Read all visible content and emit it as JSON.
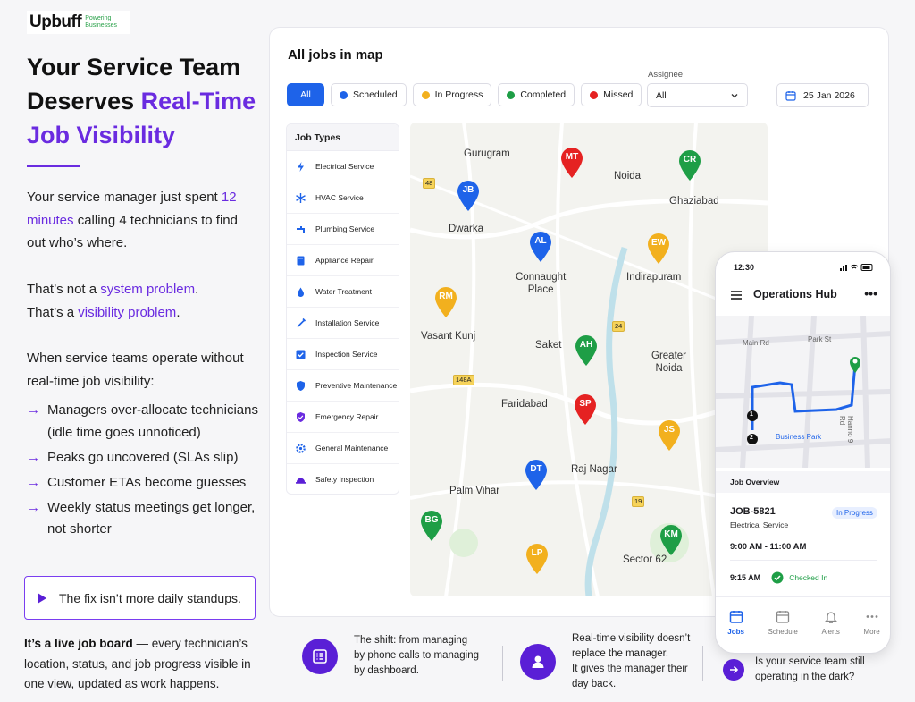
{
  "brand": {
    "name": "Upbuff",
    "tagline_1": "Powering",
    "tagline_2": "Businesses"
  },
  "hero": {
    "line1": "Your Service Team",
    "line2_a": "Deserves ",
    "line2_b": "Real-Time",
    "line3": "Job Visibility"
  },
  "intro": {
    "a": "Your service manager just spent ",
    "b": "12 minutes",
    "c": " calling 4 technicians to find out who’s where."
  },
  "problem": {
    "a1": "That’s not a ",
    "a2": "system problem",
    "a3": ".",
    "b1": "That’s a ",
    "b2": "visibility problem",
    "b3": "."
  },
  "lead": "When service teams operate without real-time job visibility:",
  "bullets": [
    "Managers over-allocate technicians (idle time goes unnoticed)",
    "Peaks go uncovered (SLAs slip)",
    "Customer ETAs become guesses",
    "Weekly status meetings get longer, not shorter"
  ],
  "callout": "The fix isn’t more daily standups.",
  "closing": {
    "bold": "It’s a live job board",
    "rest": " — every technician’s location, status, and job progress visible in one view, updated as work happens."
  },
  "card": {
    "title": "All jobs in map",
    "filters": [
      "All",
      "Scheduled",
      "In Progress",
      "Completed",
      "Missed"
    ],
    "filter_colors": [
      "#1e63e9",
      "#1e63e9",
      "#f2b01e",
      "#1e9e46",
      "#e52222"
    ],
    "assignee_label": "Assignee",
    "assignee_value": "All",
    "date": "25 Jan 2026",
    "job_types_title": "Job Types",
    "job_types": [
      "Electrical Service",
      "HVAC Service",
      "Plumbing Service",
      "Appliance Repair",
      "Water Treatment",
      "Installation Service",
      "Inspection Service",
      "Preventive Maintenance",
      "Emergency Repair",
      "General Maintenance",
      "Safety Inspection"
    ],
    "places": {
      "gurugram": "Gurugram",
      "noida": "Noida",
      "ghaziabad": "Ghaziabad",
      "dwarka": "Dwarka",
      "connaught_1": "Connaught",
      "connaught_2": "Place",
      "indirapuram": "Indirapuram",
      "vasant": "Vasant Kunj",
      "saket": "Saket",
      "greater_1": "Greater",
      "greater_2": "Noida",
      "faridabad": "Faridabad",
      "rajnagar": "Raj Nagar",
      "palam": "Palm Vihar",
      "sector": "Sector 62"
    },
    "roads": [
      "48",
      "24",
      "148A",
      "19"
    ],
    "pins": [
      {
        "initials": "MT",
        "color": "#e52222"
      },
      {
        "initials": "CR",
        "color": "#1e9e46"
      },
      {
        "initials": "JB",
        "color": "#1e63e9"
      },
      {
        "initials": "AL",
        "color": "#1e63e9"
      },
      {
        "initials": "EW",
        "color": "#f2b01e"
      },
      {
        "initials": "RM",
        "color": "#f2b01e"
      },
      {
        "initials": "AH",
        "color": "#1e9e46"
      },
      {
        "initials": "SP",
        "color": "#e52222"
      },
      {
        "initials": "JS",
        "color": "#f2b01e"
      },
      {
        "initials": "DT",
        "color": "#1e63e9"
      },
      {
        "initials": "BG",
        "color": "#1e9e46"
      },
      {
        "initials": "KM",
        "color": "#1e9e46"
      },
      {
        "initials": "LP",
        "color": "#f2b01e"
      }
    ]
  },
  "phone": {
    "time": "12:30",
    "title": "Operations Hub",
    "streets": {
      "main": "Main Rd",
      "park": "Park St",
      "hanno": "Hanno 9 Rd",
      "business": "Business Park"
    },
    "section": "Job Overview",
    "job_id": "JOB-5821",
    "job_type": "Electrical Service",
    "status": "In Progress",
    "window": "9:00 AM - 11:00 AM",
    "check_time": "9:15 AM",
    "check_label": "Checked In",
    "tabs": [
      "Jobs",
      "Schedule",
      "Alerts",
      "More"
    ]
  },
  "bottom": {
    "shift_1": "The shift: from managing",
    "shift_2": "by phone calls to managing",
    "shift_3": "by dashboard.",
    "rt_1": "Real-time visibility doesn’t",
    "rt_2": "replace the manager.",
    "rt_3": "It gives the manager their",
    "rt_4": "day back.",
    "q_1": "Is your service team still",
    "q_2": "operating in the dark?"
  }
}
